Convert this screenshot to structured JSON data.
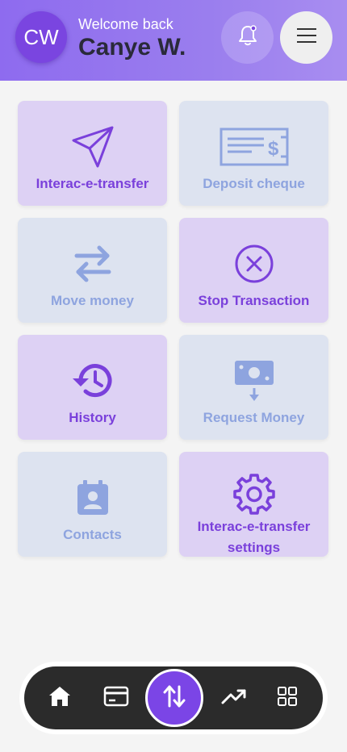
{
  "header": {
    "avatar_initials": "CW",
    "welcome_text": "Welcome back",
    "user_name": "Canye W.",
    "bell_icon": "bell-icon",
    "menu_icon": "hamburger-menu-icon"
  },
  "tiles": [
    {
      "label": "Interac-e-transfer",
      "icon": "paper-plane-icon",
      "theme": "purple"
    },
    {
      "label": "Deposit cheque",
      "icon": "cheque-icon",
      "theme": "blue"
    },
    {
      "label": "Move money",
      "icon": "swap-arrows-icon",
      "theme": "blue"
    },
    {
      "label": "Stop Transaction",
      "icon": "cancel-circle-icon",
      "theme": "purple"
    },
    {
      "label": "History",
      "icon": "history-icon",
      "theme": "purple"
    },
    {
      "label": "Request Money",
      "icon": "cash-request-icon",
      "theme": "blue"
    },
    {
      "label": "Contacts",
      "icon": "contacts-icon",
      "theme": "blue"
    },
    {
      "label": "Interac-e-transfer settings",
      "icon": "gear-icon",
      "theme": "purple"
    }
  ],
  "bottom_nav": {
    "items": [
      "home-icon",
      "card-icon",
      "transfer-icon",
      "trending-up-icon",
      "grid-icon"
    ],
    "active": "transfer-icon"
  },
  "colors": {
    "accent_purple": "#7a40db",
    "accent_blue": "#8ea4df",
    "tile_purple_bg": "#ddd1f4",
    "tile_blue_bg": "#dde3f0",
    "nav_bg": "#2b2b2b"
  }
}
